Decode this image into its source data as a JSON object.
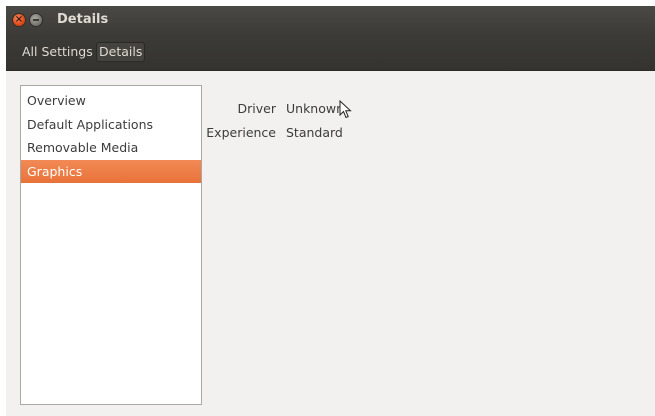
{
  "window": {
    "title": "Details"
  },
  "toolbar": {
    "all_settings_label": "All Settings",
    "details_label": "Details"
  },
  "sidebar": {
    "items": [
      {
        "label": "Overview",
        "selected": false
      },
      {
        "label": "Default Applications",
        "selected": false
      },
      {
        "label": "Removable Media",
        "selected": false
      },
      {
        "label": "Graphics",
        "selected": true
      }
    ]
  },
  "details": {
    "driver_label": "Driver",
    "driver_value": "Unknown",
    "experience_label": "Experience",
    "experience_value": "Standard"
  },
  "colors": {
    "accent": "#e8733a",
    "titlebar": "#3c3b37",
    "background": "#f2f1f0"
  }
}
